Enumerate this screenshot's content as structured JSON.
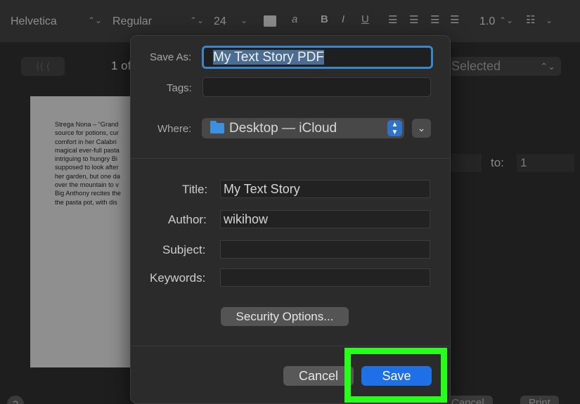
{
  "toolbar": {
    "font_family": "Helvetica",
    "font_style": "Regular",
    "font_size": "24",
    "bold": "B",
    "italic": "I",
    "underline": "U",
    "line_spacing": "1.0",
    "strike_glyph": "a"
  },
  "print_panel": {
    "page_count": "1 of",
    "selected": "Selected",
    "to_label": "to:",
    "to_value": "1",
    "cancel": "Cancel",
    "print": "Print",
    "help": "?"
  },
  "preview": {
    "lines": [
      "Strega Nona – “Grand",
      "source for potions, cur",
      "comfort in her Calabri",
      "magical ever-full pasta",
      "intriguing to hungry Bi",
      "supposed to look after",
      "her garden, but one da",
      "over the mountain to v",
      "Big Anthony recites the",
      "the pasta pot, with dis"
    ]
  },
  "dialog": {
    "save_as_label": "Save As:",
    "save_as_value": "My Text Story PDF",
    "tags_label": "Tags:",
    "where_label": "Where:",
    "where_value": "Desktop — iCloud",
    "title_label": "Title:",
    "title_value": "My Text Story",
    "author_label": "Author:",
    "author_value": "wikihow",
    "subject_label": "Subject:",
    "subject_value": "",
    "keywords_label": "Keywords:",
    "keywords_value": "",
    "security_button": "Security Options...",
    "cancel_button": "Cancel",
    "save_button": "Save"
  },
  "colors": {
    "accent": "#1f70e6",
    "highlight": "#27ff1a",
    "focus_ring": "#3a86c9"
  }
}
